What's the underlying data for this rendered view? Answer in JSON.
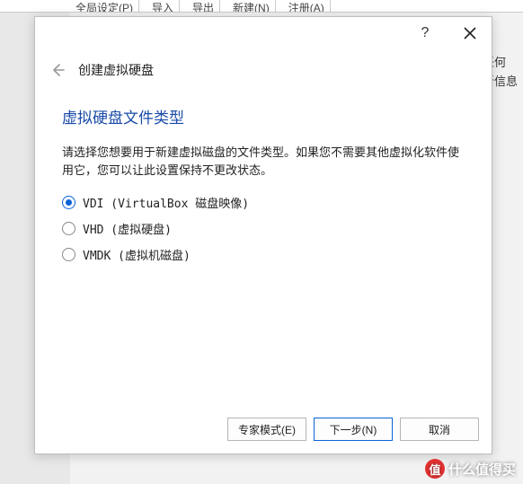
{
  "bg": {
    "toolbar": [
      "全局设定(P)",
      "导入",
      "导出",
      "新建(N)",
      "注册(A)"
    ],
    "right_lines": [
      "任何",
      "新信息"
    ]
  },
  "dialog": {
    "help_symbol": "?",
    "header_title": "创建虚拟硬盘",
    "section_title": "虚拟硬盘文件类型",
    "description": "请选择您想要用于新建虚拟磁盘的文件类型。如果您不需要其他虚拟化软件使用它，您可以让此设置保持不更改状态。",
    "options": [
      {
        "label": "VDI (VirtualBox 磁盘映像)",
        "selected": true
      },
      {
        "label": "VHD (虚拟硬盘)",
        "selected": false
      },
      {
        "label": "VMDK (虚拟机磁盘)",
        "selected": false
      }
    ],
    "buttons": {
      "expert": "专家模式(E)",
      "next": "下一步(N)",
      "cancel": "取消"
    }
  },
  "watermark": {
    "badge": "值",
    "text": "什么值得买"
  }
}
